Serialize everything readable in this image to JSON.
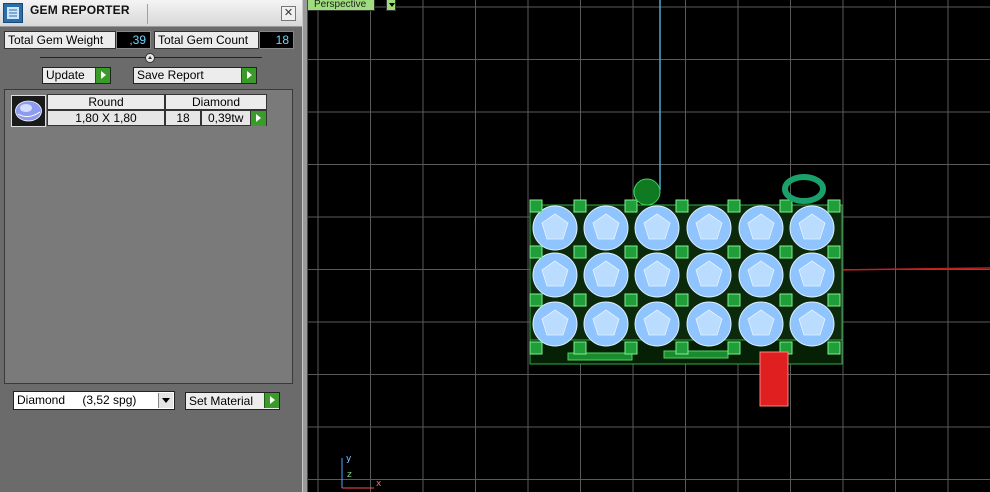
{
  "titlebar": {
    "title": "GEM REPORTER",
    "close": "✕"
  },
  "stats": {
    "weight_label": "Total Gem Weight",
    "weight_value": ",39",
    "count_label": "Total Gem Count",
    "count_value": "18"
  },
  "buttons": {
    "update": "Update",
    "save_report": "Save Report",
    "set_material": "Set Material"
  },
  "gem_list": {
    "headers": [
      "Round",
      "Diamond"
    ],
    "rows": [
      {
        "size": "1,80 X 1,80",
        "count": "18",
        "weight": "0,39tw"
      }
    ]
  },
  "material": {
    "selected_name": "Diamond",
    "selected_density": "(3,52 spg)"
  },
  "viewport": {
    "view_name": "Perspective",
    "axis_y": "y",
    "axis_z": "z",
    "axis_x": "x"
  },
  "colors": {
    "panel_bg": "#6b6b6b",
    "value_text": "#6fd4ff",
    "accent_green": "#3a9a2a",
    "grid_line": "#5a5a5a",
    "gem_blue": "#8fc4ff",
    "prong_green": "#1f9e3a",
    "marker_red": "#e02020"
  }
}
